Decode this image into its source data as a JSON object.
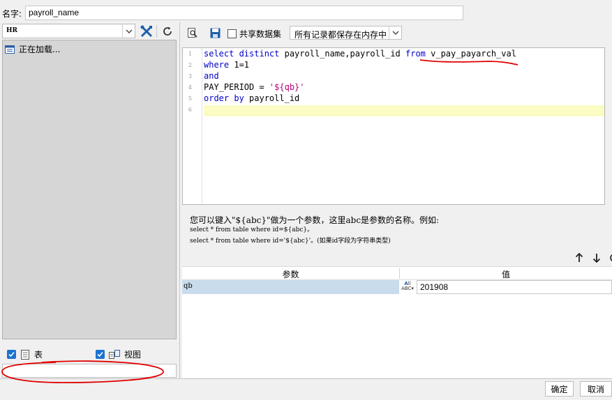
{
  "name_row": {
    "label": "名字:",
    "value": "payroll_name"
  },
  "left_panel": {
    "db_select": "HR",
    "tree_item": "正在加载...",
    "filters": {
      "table_label": "表",
      "view_label": "视图"
    }
  },
  "toolbar": {
    "share_dataset_label": "共享数据集",
    "storage_select": "所有记录都保存在内存中"
  },
  "editor": {
    "line_numbers": [
      "1",
      "2",
      "3",
      "4",
      "5",
      "6"
    ],
    "lines": [
      {
        "parts": [
          [
            "kw",
            "select distinct"
          ],
          [
            "txt",
            " payroll_name,payroll_id "
          ],
          [
            "kw",
            "from"
          ],
          [
            "txt",
            " v_pay_payarch_val"
          ]
        ]
      },
      {
        "parts": [
          [
            "kw",
            "where"
          ],
          [
            "txt",
            " 1=1"
          ]
        ]
      },
      {
        "parts": [
          [
            "kw",
            "and"
          ]
        ]
      },
      {
        "parts": [
          [
            "txt",
            "PAY_PERIOD = "
          ],
          [
            "str",
            "'${qb}'"
          ]
        ]
      },
      {
        "parts": [
          [
            "kw",
            "order by"
          ],
          [
            "txt",
            " payroll_id"
          ]
        ]
      },
      {
        "parts": []
      }
    ]
  },
  "help": {
    "line1": "您可以键入\"${abc}\"做为一个参数，这里abc是参数的名称。例如:",
    "line2": "select * from table where id=${abc}。",
    "line3": "select * from table where id='${abc}'。(如果id字段为字符串类型)"
  },
  "param_table": {
    "header_param": "参数",
    "header_value": "值",
    "rows": [
      {
        "name": "qb",
        "type_icon": "abc-type-icon",
        "value": "201908"
      }
    ]
  },
  "buttons": {
    "ok": "确定",
    "cancel": "取消"
  },
  "colors": {
    "keyword": "#0000c8",
    "string": "#b4007a",
    "annotation": "#e00000",
    "active_line": "#fbfbc4",
    "selected_row": "#c9dced"
  }
}
